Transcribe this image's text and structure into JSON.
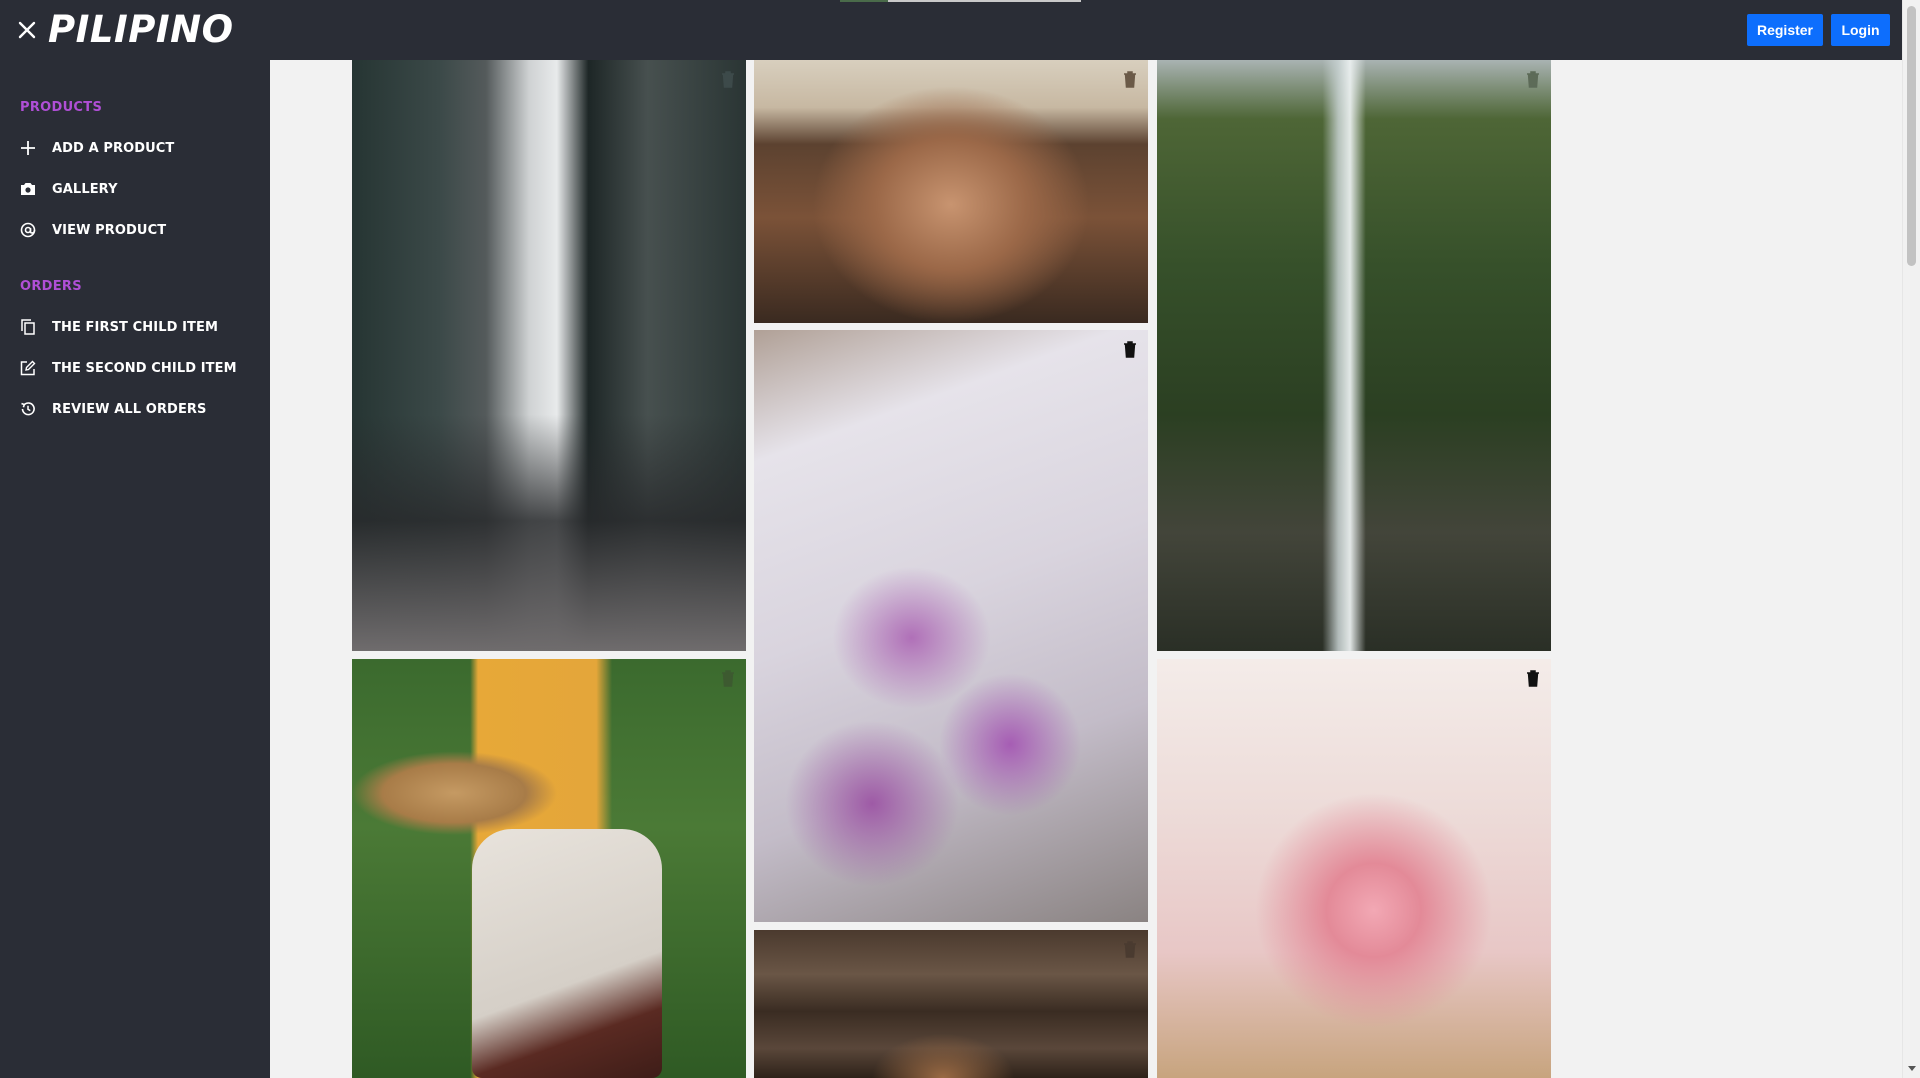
{
  "header": {
    "brand": "PILIPINO",
    "register_label": "Register",
    "login_label": "Login",
    "close_icon": "close-icon",
    "loading_progress": 0.2
  },
  "sidebar": {
    "sections": [
      {
        "title": "PRODUCTS",
        "items": [
          {
            "label": "ADD A PRODUCT",
            "icon": "plus-icon"
          },
          {
            "label": "GALLERY",
            "icon": "camera-icon"
          },
          {
            "label": "VIEW PRODUCT",
            "icon": "at-icon"
          }
        ]
      },
      {
        "title": "ORDERS",
        "items": [
          {
            "label": "THE FIRST CHILD ITEM",
            "icon": "copy-icon"
          },
          {
            "label": "THE SECOND CHILD ITEM",
            "icon": "edit-icon"
          },
          {
            "label": "REVIEW ALL ORDERS",
            "icon": "history-icon"
          }
        ]
      }
    ],
    "accent_color": "#b04fd6"
  },
  "gallery": {
    "photos": [
      {
        "subject": "city-buildings-photo",
        "delete_icon": "trash-icon"
      },
      {
        "subject": "woman-in-hat-photo",
        "delete_icon": "trash-icon"
      },
      {
        "subject": "waterfall-photo",
        "delete_icon": "trash-icon"
      },
      {
        "subject": "tulip-bouquet-photo",
        "delete_icon": "trash-icon"
      },
      {
        "subject": "straw-hat-person-photo",
        "delete_icon": "trash-icon"
      },
      {
        "subject": "pink-roses-photo",
        "delete_icon": "trash-icon"
      },
      {
        "subject": "bear-on-wood-photo",
        "delete_icon": "trash-icon"
      }
    ]
  },
  "colors": {
    "header_bg": "#2a2d36",
    "sidebar_bg": "#2a2d36",
    "button_primary": "#0d6efd",
    "page_bg": "#f2f2f2"
  }
}
